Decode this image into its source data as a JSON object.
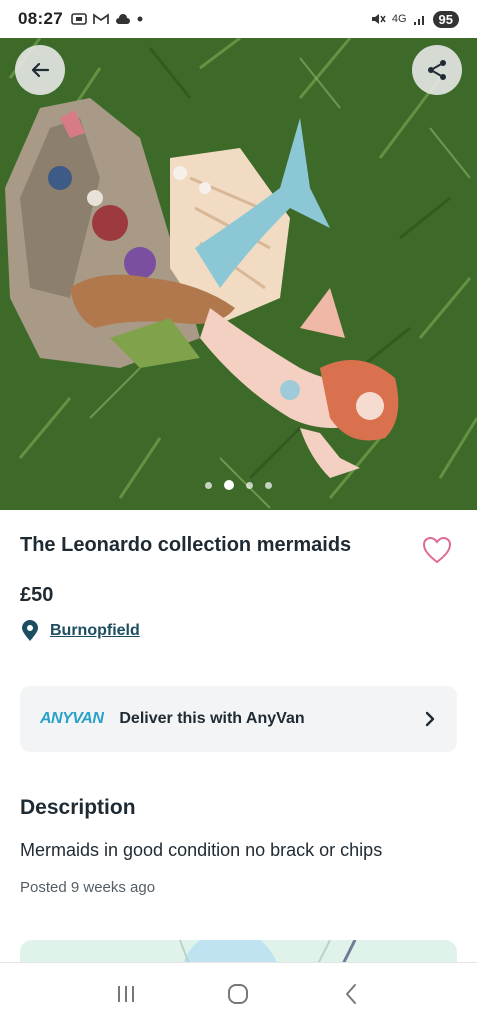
{
  "status_bar": {
    "time": "08:27",
    "network": "4G",
    "battery": "95"
  },
  "listing": {
    "title": "The Leonardo collection mermaids",
    "price": "£50",
    "location": "Burnopfield",
    "image_count": 4,
    "active_image_index": 1
  },
  "delivery": {
    "logo_text": "ANYVAN",
    "label": "Deliver this with AnyVan"
  },
  "description": {
    "heading": "Description",
    "body": "Mermaids in good condition no brack or chips",
    "posted": "Posted 9 weeks ago"
  },
  "colors": {
    "accent_heart": "#e06a97",
    "link": "#1d4d61",
    "anyvan": "#2aa1c9",
    "map_tint": "#dff3ea"
  },
  "icons": {
    "back": "arrow-left-icon",
    "share": "share-icon",
    "favourite": "heart-outline-icon",
    "location": "map-pin-icon",
    "chevron": "chevron-right-icon"
  }
}
